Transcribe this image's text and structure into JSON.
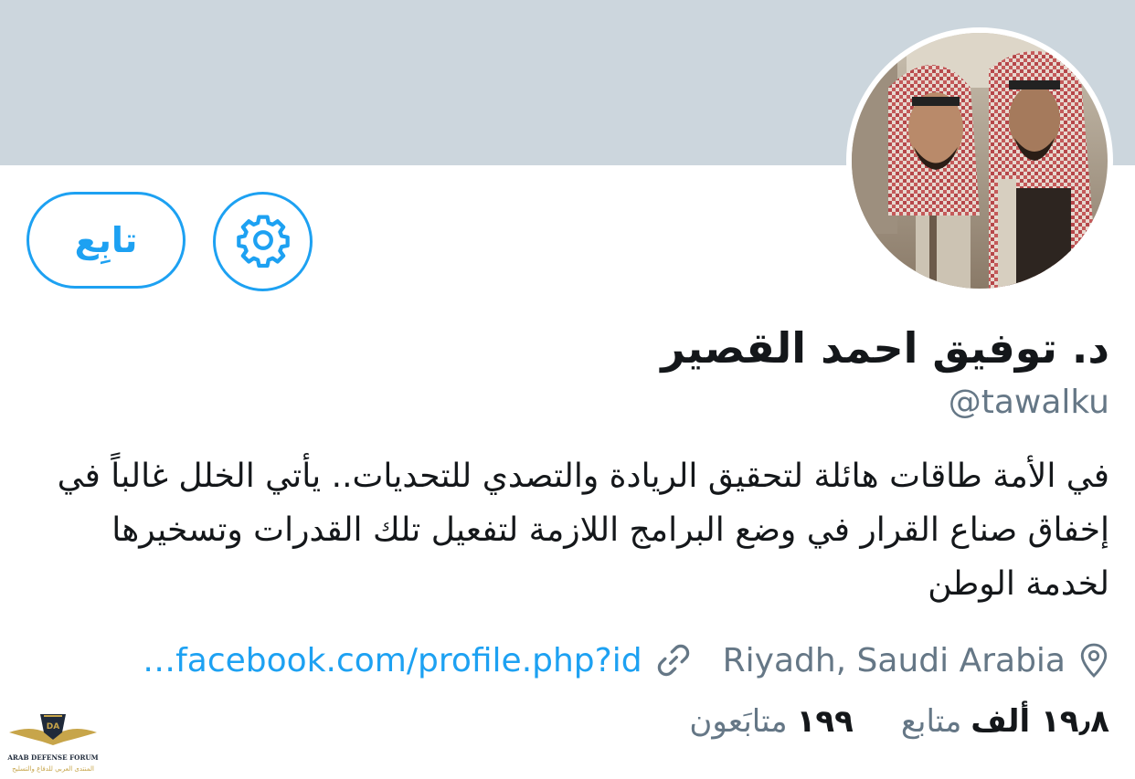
{
  "profile": {
    "display_name": "د. توفيق احمد القصير",
    "handle": "@tawalku",
    "bio": "في الأمة طاقات هائلة لتحقيق الريادة والتصدي للتحديات.. يأتي الخلل غالباً في إخفاق صناع القرار في وضع البرامج اللازمة لتفعيل تلك القدرات وتسخيرها لخدمة الوطن",
    "location": "Riyadh, Saudi Arabia",
    "website": "…facebook.com/profile.php?id"
  },
  "actions": {
    "follow_label": "تابِع"
  },
  "stats": {
    "following_count": "١٩٩",
    "following_label": "متابَعون",
    "followers_count": "١٩٫٨ ألف",
    "followers_label": "متابع"
  },
  "watermark": {
    "title": "ARAB DEFENSE FORUM",
    "subtitle": "المنتدى العربي للدفاع والتسليح",
    "monogram": "DA"
  },
  "colors": {
    "accent": "#1da1f2",
    "banner": "#ccd6dd",
    "secondary_text": "#657786"
  }
}
